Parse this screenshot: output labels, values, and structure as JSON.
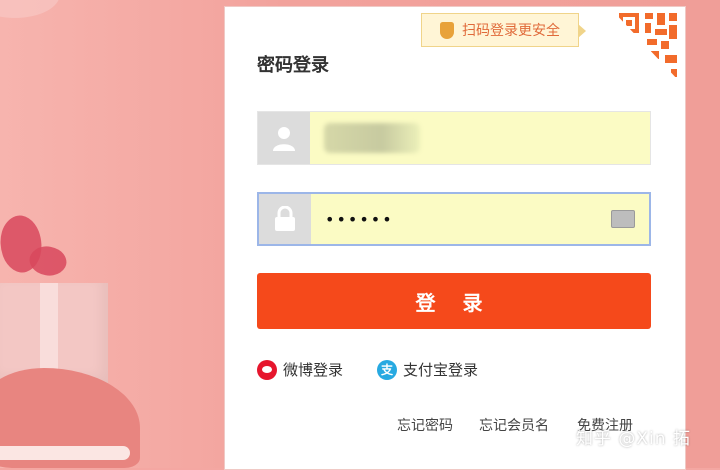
{
  "login": {
    "qr_tip": "扫码登录更安全",
    "title": "密码登录",
    "username_value": "",
    "password_value": "••••••",
    "submit_label": "登 录",
    "alt_weibo": "微博登录",
    "alt_alipay": "支付宝登录",
    "alipay_glyph": "支",
    "forgot_password": "忘记密码",
    "forgot_username": "忘记会员名",
    "register": "免费注册"
  },
  "watermark": "知乎 @Xin 拓",
  "colors": {
    "accent": "#f5491b",
    "field_background": "#fbfbc4",
    "tip_text": "#e06a3a",
    "background": "#f4a7a2"
  },
  "icons": [
    "shield-icon",
    "qr-code-icon",
    "user-icon",
    "lock-icon",
    "keyboard-icon",
    "weibo-icon",
    "alipay-icon"
  ]
}
